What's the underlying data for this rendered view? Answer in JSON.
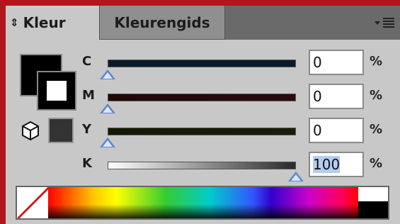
{
  "tabs": [
    {
      "label": "Kleur",
      "active": true
    },
    {
      "label": "Kleurengids",
      "active": false
    }
  ],
  "tab_arrow_glyph": "⇕",
  "colors": {
    "frame": "#b0161c",
    "panel": "#c8c8c8",
    "thumb": "#5d86c8",
    "selection": "#b4cdf0"
  },
  "channels": [
    {
      "label": "C",
      "value": "0",
      "unit": "%",
      "level": 0,
      "gradient": [
        "#0b1a28",
        "#0b1a28"
      ]
    },
    {
      "label": "M",
      "value": "0",
      "unit": "%",
      "level": 0,
      "gradient": [
        "#220709",
        "#2a0a0c"
      ]
    },
    {
      "label": "Y",
      "value": "0",
      "unit": "%",
      "level": 0,
      "gradient": [
        "#141806",
        "#181d08"
      ]
    },
    {
      "label": "K",
      "value": "100",
      "unit": "%",
      "level": 1,
      "gradient": [
        "#ffffff",
        "#2a2a2a"
      ],
      "selected": true
    }
  ],
  "icons": {
    "menu": "panel-menu-icon",
    "cube": "cube-icon",
    "none": "none-swatch-icon"
  }
}
